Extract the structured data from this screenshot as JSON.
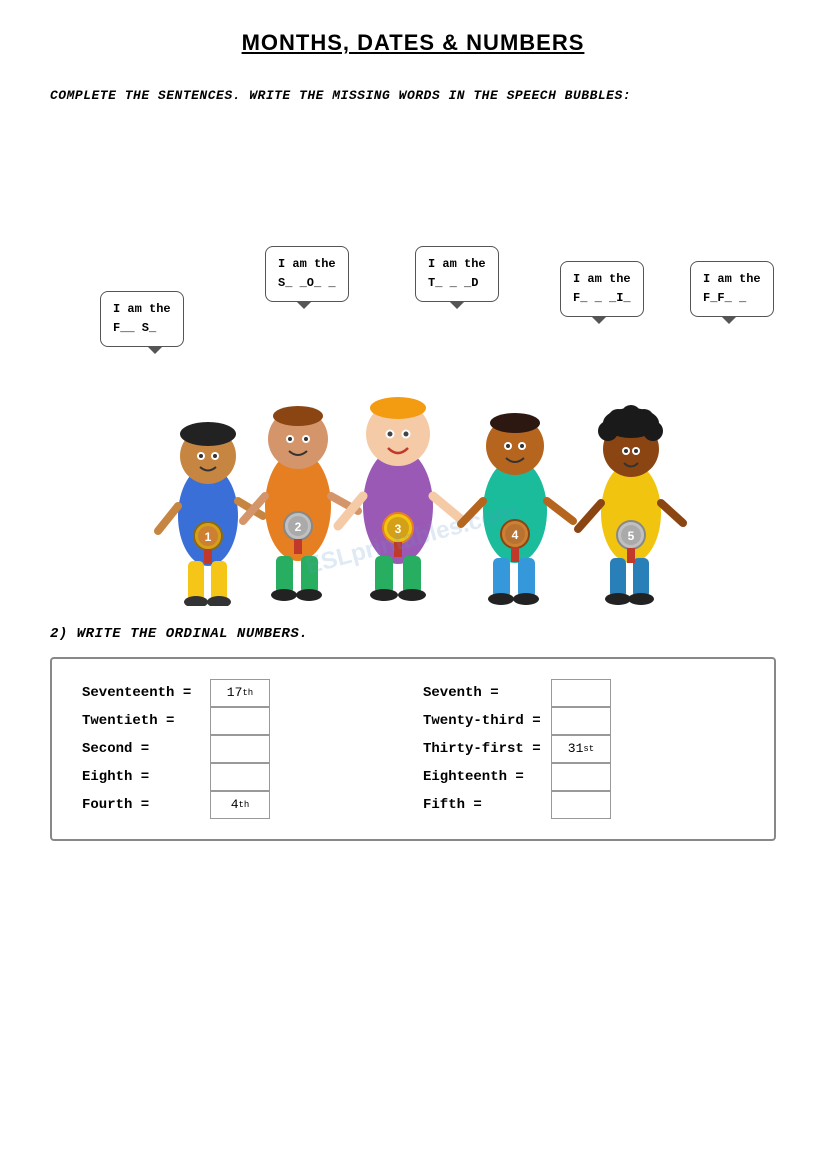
{
  "title": "MONTHS, DATES & NUMBERS",
  "instruction1": "COMPLETE THE SENTENCES. WRITE THE MISSING WORDS IN THE SPEECH BUBBLES:",
  "bubbles": [
    {
      "id": 1,
      "line1": "I am the",
      "line2": "F__ S_"
    },
    {
      "id": 2,
      "line1": "I am the",
      "line2": "S_ _O_ _"
    },
    {
      "id": 3,
      "line1": "I am the",
      "line2": "T_ _ _D"
    },
    {
      "id": 4,
      "line1": "I am the",
      "line2": "F_ _ _I_"
    },
    {
      "id": 5,
      "line1": "I am the",
      "line2": "F_F_ _"
    }
  ],
  "section2_title": "2) WRITE THE ORDINAL NUMBERS.",
  "left_items": [
    {
      "label": "Seventeenth =",
      "answer": "17th",
      "has_answer": true
    },
    {
      "label": "Twentieth =",
      "answer": "",
      "has_answer": false
    },
    {
      "label": "Second =",
      "answer": "",
      "has_answer": false
    },
    {
      "label": "Eighth =",
      "answer": "",
      "has_answer": false
    },
    {
      "label": "Fourth =",
      "answer": "4th",
      "has_answer": true
    }
  ],
  "right_items": [
    {
      "label": "Seventh =",
      "answer": "",
      "has_answer": false
    },
    {
      "label": "Twenty-third =",
      "answer": "",
      "has_answer": false
    },
    {
      "label": "Thirty-first =",
      "answer": "31st",
      "has_answer": true
    },
    {
      "label": "Eighteenth =",
      "answer": "",
      "has_answer": false
    },
    {
      "label": "Fifth =",
      "answer": "",
      "has_answer": false
    }
  ]
}
